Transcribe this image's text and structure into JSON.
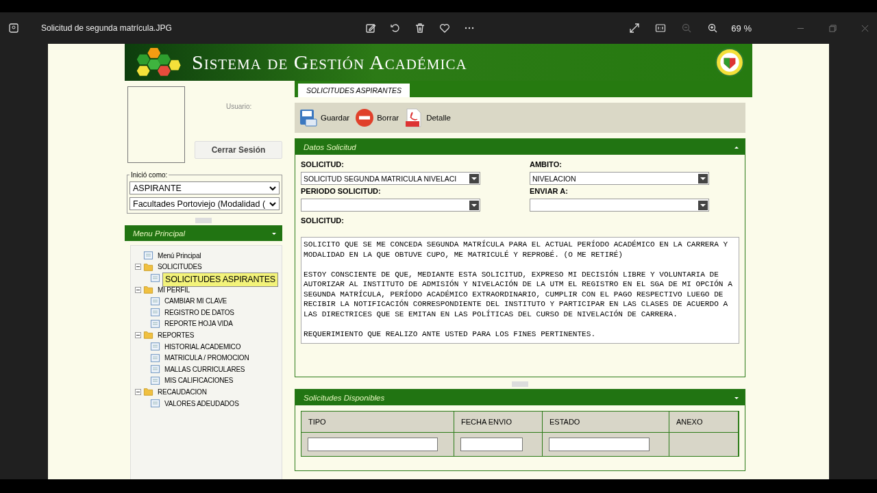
{
  "viewer": {
    "title": "Solicitud de segunda matrícula.JPG",
    "zoom": "69 %",
    "tools": [
      {
        "kind": "edit"
      },
      {
        "kind": "rotate"
      },
      {
        "kind": "delete"
      },
      {
        "kind": "heart"
      },
      {
        "kind": "more"
      }
    ],
    "view_tools": [
      {
        "kind": "expand",
        "disabled": false
      },
      {
        "kind": "actual",
        "disabled": false
      },
      {
        "kind": "zoomout",
        "disabled": true
      },
      {
        "kind": "zoomin",
        "disabled": false
      }
    ]
  },
  "app": {
    "title": "Sistema de Gestión Académica"
  },
  "user": {
    "label": "Usuario:",
    "logout": "Cerrar Sesión"
  },
  "role": {
    "legend": "Inició como:",
    "selects": [
      "ASPIRANTE",
      "Facultades Portoviejo (Modalidad ("
    ]
  },
  "menu": {
    "title": "Menu Principal",
    "items": [
      {
        "label": "Menú Principal",
        "kind": "page",
        "selected": false
      },
      {
        "label": "SOLICITUDES",
        "kind": "folder",
        "expanded": true,
        "children": [
          {
            "label": "SOLICITUDES ASPIRANTES",
            "kind": "page",
            "selected": true
          }
        ]
      },
      {
        "label": "MI PERFIL",
        "kind": "folder",
        "expanded": true,
        "children": [
          {
            "label": "CAMBIAR MI CLAVE",
            "kind": "page",
            "selected": false
          },
          {
            "label": "REGISTRO DE DATOS",
            "kind": "page",
            "selected": false
          },
          {
            "label": "REPORTE HOJA VIDA",
            "kind": "page",
            "selected": false
          }
        ]
      },
      {
        "label": "REPORTES",
        "kind": "folder",
        "expanded": true,
        "children": [
          {
            "label": "HISTORIAL ACADEMICO",
            "kind": "page",
            "selected": false
          },
          {
            "label": "MATRICULA / PROMOCION",
            "kind": "page",
            "selected": false
          },
          {
            "label": "MALLAS CURRICULARES",
            "kind": "page",
            "selected": false
          },
          {
            "label": "MIS CALIFICACIONES",
            "kind": "page",
            "selected": false
          }
        ]
      },
      {
        "label": "RECAUDACION",
        "kind": "folder",
        "expanded": true,
        "children": [
          {
            "label": "VALORES ADEUDADOS",
            "kind": "page",
            "selected": false
          }
        ]
      }
    ]
  },
  "tabs": [
    {
      "label": "SOLICITUDES ASPIRANTES",
      "selected": true
    }
  ],
  "toolbar": [
    {
      "label": "Guardar",
      "kind": "save"
    },
    {
      "label": "Borrar",
      "kind": "delete"
    },
    {
      "label": "Detalle",
      "kind": "pdf"
    }
  ],
  "form": {
    "title": "Datos Solicitud",
    "fields": [
      {
        "label": "SOLICITUD:",
        "value": "SOLICITUD SEGUNDA MATRICULA NIVELACI"
      },
      {
        "label": "AMBITO:",
        "value": "NIVELACION"
      },
      {
        "label": "PERIODO SOLICITUD:"
      },
      {
        "label": "ENVIAR A:"
      }
    ],
    "text_label": "SOLICITUD:",
    "text": [
      "SOLICITO QUE SE ME CONCEDA SEGUNDA MATRÍCULA PARA EL ACTUAL PERÍODO ACADÉMICO EN LA CARRERA Y MODALIDAD EN LA QUE OBTUVE CUPO, ME MATRICULÉ Y REPROBÉ. (O ME RETIRÉ)",
      "ESTOY CONSCIENTE DE QUE, MEDIANTE ESTA SOLICITUD, EXPRESO MI DECISIÓN LIBRE Y VOLUNTARIA DE AUTORIZAR AL INSTITUTO DE ADMISIÓN Y NIVELACIÓN DE LA UTM EL REGISTRO EN EL SGA DE MI OPCIÓN A SEGUNDA MATRÍCULA, PERÍODO ACADÉMICO EXTRAORDINARIO, CUMPLIR CON EL PAGO RESPECTIVO LUEGO DE RECIBIR LA NOTIFICACIÓN CORRESPONDIENTE DEL INSTITUTO Y PARTICIPAR EN LAS CLASES DE ACUERDO A LAS DIRECTRICES QUE SE EMITAN EN LAS POLÍTICAS DEL CURSO DE NIVELACIÓN DE CARRERA.",
      "REQUERIMIENTO QUE REALIZO ANTE USTED PARA LOS FINES PERTINENTES."
    ]
  },
  "table": {
    "title": "Solicitudes Disponibles",
    "columns": [
      {
        "label": "TIPO",
        "filter": true
      },
      {
        "label": "FECHA ENVIO",
        "filter": true
      },
      {
        "label": "ESTADO",
        "filter": true
      },
      {
        "label": "ANEXO",
        "filter": false
      }
    ]
  }
}
